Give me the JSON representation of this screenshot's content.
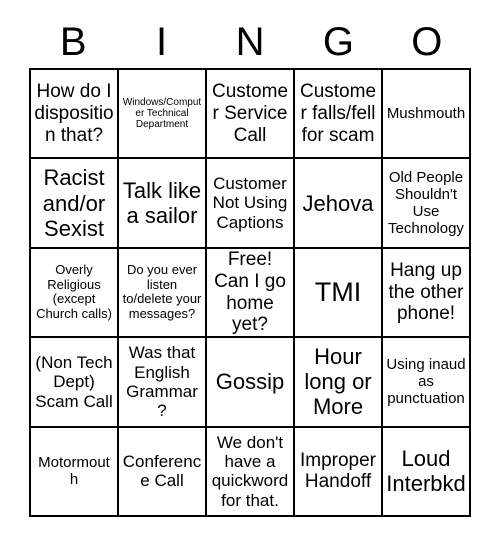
{
  "header": {
    "letters": [
      "B",
      "I",
      "N",
      "G",
      "O"
    ]
  },
  "grid": {
    "rows": [
      [
        {
          "text": "How do I disposition that?",
          "size": "l"
        },
        {
          "text": "Windows/Computer Technical Department",
          "size": "xxs"
        },
        {
          "text": "Customer Service Call",
          "size": "l"
        },
        {
          "text": "Customer falls/fell for scam",
          "size": "l"
        },
        {
          "text": "Mushmouth",
          "size": "s"
        }
      ],
      [
        {
          "text": "Racist and/or Sexist",
          "size": "xl"
        },
        {
          "text": "Talk like a sailor",
          "size": "xl"
        },
        {
          "text": "Customer Not Using Captions",
          "size": "m"
        },
        {
          "text": "Jehova",
          "size": "xl"
        },
        {
          "text": "Old People Shouldn't Use Technology",
          "size": "s"
        }
      ],
      [
        {
          "text": "Overly Religious (except Church calls)",
          "size": "xs"
        },
        {
          "text": "Do you ever listen to/delete your messages?",
          "size": "xs"
        },
        {
          "text": "Free! Can I go home yet?",
          "size": "l"
        },
        {
          "text": "TMI",
          "size": "xxl"
        },
        {
          "text": "Hang up the other phone!",
          "size": "l"
        }
      ],
      [
        {
          "text": "(Non Tech Dept) Scam Call",
          "size": "m"
        },
        {
          "text": "Was that English Grammar?",
          "size": "m"
        },
        {
          "text": "Gossip",
          "size": "xl"
        },
        {
          "text": "Hour long or More",
          "size": "xl"
        },
        {
          "text": "Using inaud as punctuation",
          "size": "s"
        }
      ],
      [
        {
          "text": "Motormouth",
          "size": "s"
        },
        {
          "text": "Conference Call",
          "size": "m"
        },
        {
          "text": "We don't have a quickword for that.",
          "size": "m"
        },
        {
          "text": "Improper Handoff",
          "size": "l"
        },
        {
          "text": "Loud Interbkd",
          "size": "xl"
        }
      ]
    ]
  }
}
